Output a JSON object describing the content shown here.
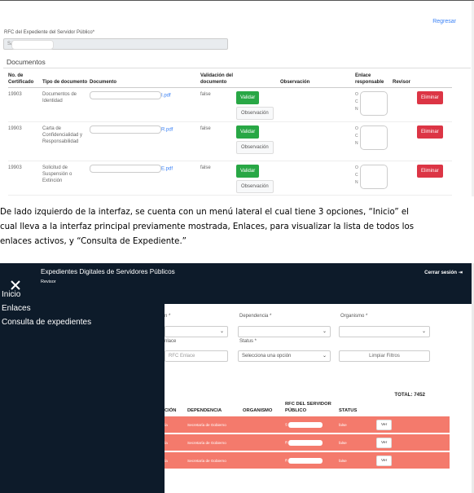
{
  "screenshot1": {
    "regresar_link": "Regresar",
    "rfc_label": "RFC del Expediente del Servidor Público*",
    "rfc_value": "SA",
    "documents_title": "Documentos",
    "headers": {
      "no_certificado": "No. de Certificado",
      "tipo_documento": "Tipo de documento",
      "documento": "Documento",
      "validacion": "Validación del documento",
      "observacion": "Observación",
      "enlace": "Enlace responsable",
      "revisor": "Revisor"
    },
    "rows": [
      {
        "cert": "19903",
        "tipo": "Documentos de Identidad",
        "doc_ext": "I.pdf",
        "validacion": "false",
        "enlace_letters": "O C N"
      },
      {
        "cert": "19903",
        "tipo": "Carta de Confidencialidad y Responsabilidad",
        "doc_ext": "R.pdf",
        "validacion": "false",
        "enlace_letters": "O C N"
      },
      {
        "cert": "19903",
        "tipo": "Solicitud de Suspensión o Extinción",
        "doc_ext": "E.pdf",
        "validacion": "false",
        "enlace_letters": "O C N"
      }
    ],
    "buttons": {
      "validar": "Validar",
      "observacion": "Observación",
      "eliminar": "Eliminar"
    }
  },
  "paragraph": {
    "line1": "De lado izquierdo de la interfaz, se cuenta con un menú lateral el cual tiene 3 opciones, “Inicio” el",
    "line2": "cual lleva a la interfaz principal previamente mostrada, Enlaces, para visualizar la lista de todos los",
    "line3": "enlaces activos, y “Consulta de Expediente.”"
  },
  "screenshot2": {
    "app_title": "Expedientes Digitales de Servidores Públicos",
    "role": "Revisor",
    "logout": "Cerrar sesión",
    "sidebar": [
      "Inicio",
      "Enlaces",
      "Consulta de expedientes"
    ],
    "filters": {
      "label_a": "n *",
      "label_dependencia": "Dependencia *",
      "label_organismo": "Organismo *",
      "label_enlace": "nlace",
      "label_status": "Status *",
      "enlace_placeholder": "RFC Enlace",
      "status_value": "Selecciona una opción",
      "limpiar": "Limpiar Filtros"
    },
    "total": "TOTAL: 7452",
    "table_headers": {
      "ubicacion": "CIÓN",
      "dependencia": "DEPENDENCIA",
      "organismo": "ORGANISMO",
      "rfc": "RFC DEL SERVIDOR PÚBLICO",
      "status": "STATUS"
    },
    "rows": [
      {
        "ubic": "ía",
        "dependencia": "Secretaría de Gobierno",
        "rfc_prefix": "S",
        "status": "false",
        "action": "Ver"
      },
      {
        "ubic": "ía",
        "dependencia": "Secretaría de Gobierno",
        "rfc_prefix": "R",
        "status": "false",
        "action": "Ver"
      },
      {
        "ubic": "ía",
        "dependencia": "Secretaría de Gobierno",
        "rfc_prefix": "R",
        "status": "false",
        "action": "Ver"
      }
    ]
  }
}
